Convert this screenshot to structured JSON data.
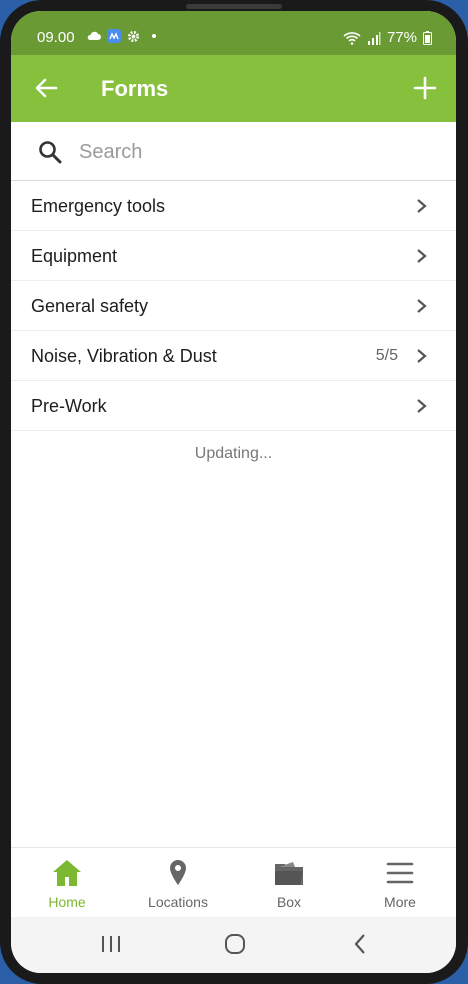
{
  "status_bar": {
    "time": "09.00",
    "battery": "77%"
  },
  "app_bar": {
    "title": "Forms"
  },
  "search": {
    "placeholder": "Search"
  },
  "list": [
    {
      "label": "Emergency tools",
      "count": ""
    },
    {
      "label": "Equipment",
      "count": ""
    },
    {
      "label": "General safety",
      "count": ""
    },
    {
      "label": "Noise, Vibration & Dust",
      "count": "5/5"
    },
    {
      "label": "Pre-Work",
      "count": ""
    }
  ],
  "status_text": "Updating...",
  "bottom_nav": [
    {
      "label": "Home",
      "icon": "home-icon",
      "active": true
    },
    {
      "label": "Locations",
      "icon": "location-pin-icon",
      "active": false
    },
    {
      "label": "Box",
      "icon": "folder-icon",
      "active": false
    },
    {
      "label": "More",
      "icon": "menu-icon",
      "active": false
    }
  ],
  "colors": {
    "app_bar": "#86c03c",
    "status_bar": "#6a9a34",
    "accent": "#7cb832"
  }
}
